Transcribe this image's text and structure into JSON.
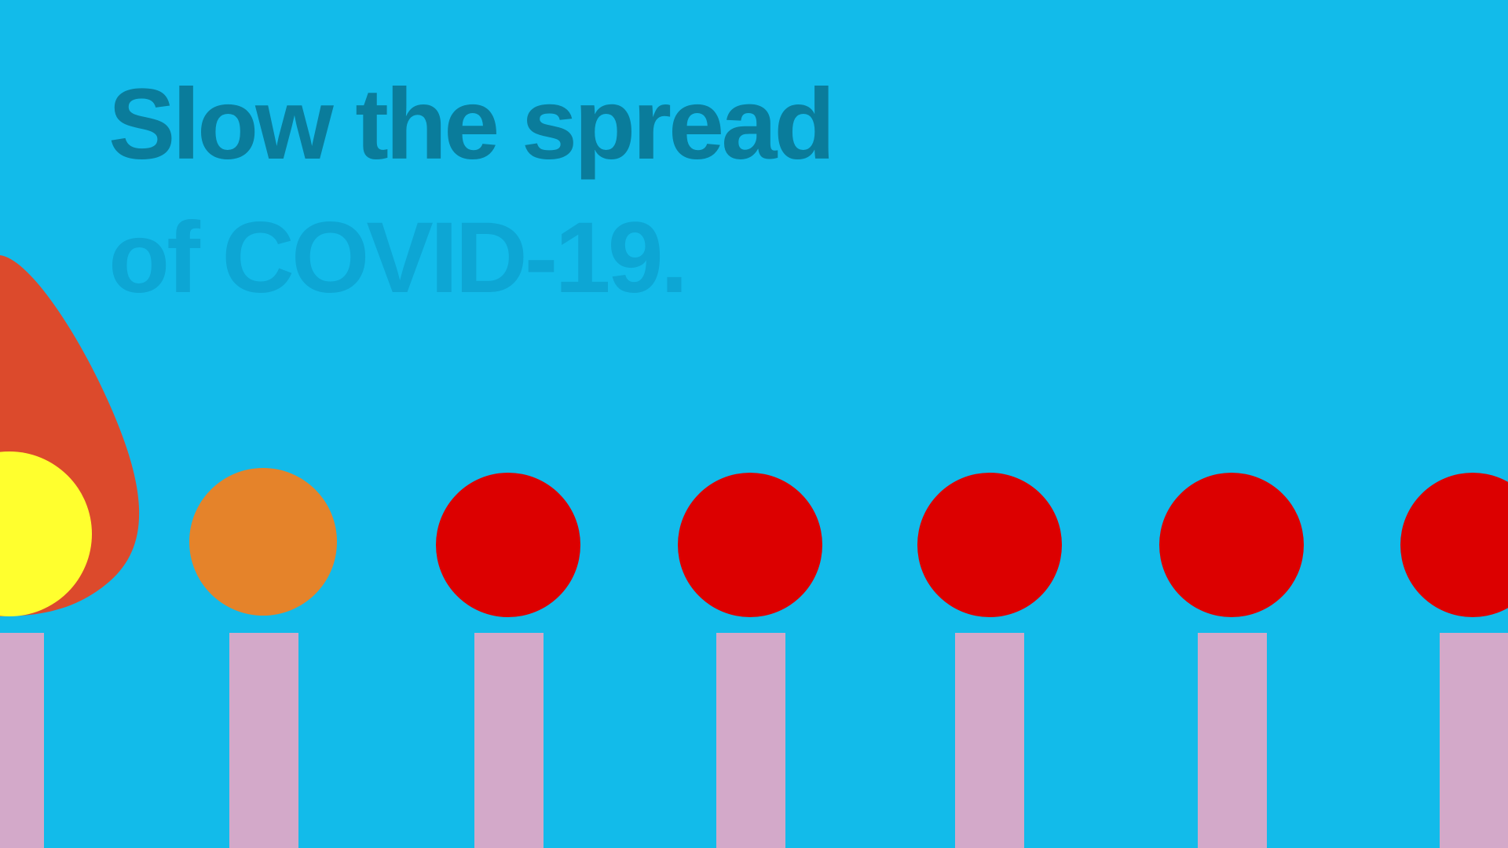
{
  "headline": {
    "line1": "Slow the spread",
    "line2": "of COVID-19."
  },
  "colors": {
    "background": "#12bbea",
    "headline_line1": "#0a7c9b",
    "headline_line2": "#0da6d4",
    "flame": "#dc4a2c",
    "burning_head": "#ffff2e",
    "warming_head": "#e5832a",
    "match_head": "#dc0000",
    "match_stick": "#d3a9c9"
  },
  "matches": [
    {
      "state": "burning",
      "color": "#ffff2e"
    },
    {
      "state": "warming",
      "color": "#e5832a"
    },
    {
      "state": "unlit",
      "color": "#dc0000"
    },
    {
      "state": "unlit",
      "color": "#dc0000"
    },
    {
      "state": "unlit",
      "color": "#dc0000"
    },
    {
      "state": "unlit",
      "color": "#dc0000"
    },
    {
      "state": "unlit",
      "color": "#dc0000"
    }
  ]
}
